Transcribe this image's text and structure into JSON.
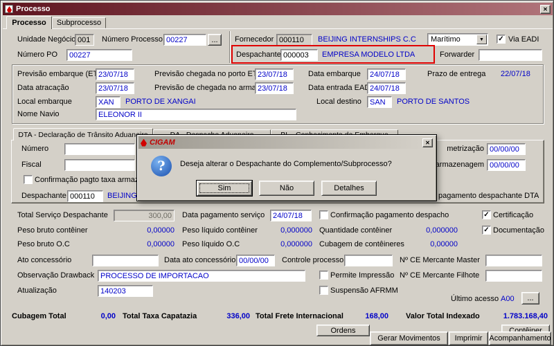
{
  "icons": {
    "close": "✕",
    "dropdown": "▼",
    "ellipsis": "...",
    "question": "?",
    "check": "✓"
  },
  "window": {
    "title": "Processo"
  },
  "main_tabs": {
    "processo": "Processo",
    "subprocesso": "Subprocesso"
  },
  "header": {
    "unidade_negocio_label": "Unidade Negócio",
    "unidade_negocio_value": "001",
    "numero_processo_label": "Número Processo",
    "numero_processo_value": "00227",
    "fornecedor_label": "Fornecedor",
    "fornecedor_code": "000110",
    "fornecedor_name": "BEIJING INTERNSHIPS C.C",
    "transporte_value": "Marítimo",
    "via_eadi_label": "Via EADI",
    "numero_po_label": "Número PO",
    "numero_po_value": "00227",
    "despachante_label": "Despachante",
    "despachante_code": "000003",
    "despachante_name": "EMPRESA MODELO LTDA",
    "forwarder_label": "Forwarder",
    "forwarder_value": ""
  },
  "dates": {
    "previsao_embarque_label": "Previsão embarque (ETD)",
    "previsao_embarque_value": "23/07/18",
    "previsao_chegada_porto_label": "Previsão chegada no porto ETA",
    "previsao_chegada_porto_value": "23/07/18",
    "data_embarque_label": "Data embarque",
    "data_embarque_value": "24/07/18",
    "prazo_entrega_label": "Prazo de entrega",
    "prazo_entrega_value": "22/07/18",
    "data_atracacao_label": "Data atracação",
    "data_atracacao_value": "23/07/18",
    "previsao_chegada_armazem_label": "Previsão de chegada no armazém",
    "previsao_chegada_armazem_value": "23/07/18",
    "data_entrada_eadi_label": "Data entrada EADI",
    "data_entrada_eadi_value": "24/07/18",
    "local_embarque_label": "Local embarque",
    "local_embarque_code": "XAN",
    "local_embarque_name": "PORTO DE XANGAI",
    "local_destino_label": "Local destino",
    "local_destino_code": "SAN",
    "local_destino_name": "PORTO DE SANTOS",
    "nome_navio_label": "Nome Navio",
    "nome_navio_value": "ELEONOR II"
  },
  "doc_tabs": {
    "dta": "DTA - Declaração de Trânsito Aduaneiro",
    "da": "DA - Despacho Aduaneiro",
    "bl": "BL - Conhecimento de Embarque"
  },
  "dta_panel": {
    "numero_label": "Número",
    "fiscal_label": "Fiscal",
    "confirmacao_pagto_label": "Confirmação pagto taxa armaze",
    "despachante_label": "Despachante",
    "despachante_code": "000110",
    "despachante_name": "BEIJING IN",
    "fragment_metrizacao": "metrização",
    "fragment_metrizacao_value": "00/00/00",
    "fragment_taxa_armazenagem": "o taxa armazenagem",
    "fragment_taxa_armazenagem_value": "00/00/00",
    "fragment_pagamento_dta": "pagamento despachante DTA"
  },
  "dialog": {
    "title": "CIGAM",
    "message": "Deseja alterar o Despachante do Complemento/Subprocesso?",
    "sim": "Sim",
    "nao": "Não",
    "detalhes": "Detalhes"
  },
  "details": {
    "total_servico_label": "Total Serviço Despachante",
    "total_servico_value": "300,00",
    "data_pagamento_label": "Data pagamento serviço",
    "data_pagamento_value": "24/07/18",
    "confirmacao_despacho_label": "Confirmação pagamento despacho",
    "certificacao_label": "Certificação",
    "peso_bruto_conteiner_label": "Peso bruto contêiner",
    "peso_bruto_conteiner_value": "0,00000",
    "peso_liquido_conteiner_label": "Peso líquido contêiner",
    "peso_liquido_conteiner_value": "0,000000",
    "quantidade_conteiner_label": "Quantidade contêiner",
    "quantidade_conteiner_value": "0,000000",
    "documentacao_label": "Documentação",
    "peso_bruto_oc_label": "Peso bruto O.C",
    "peso_bruto_oc_value": "0,00000",
    "peso_liquido_oc_label": "Peso líquido O.C",
    "peso_liquido_oc_value": "0,000000",
    "cubagem_conteineres_label": "Cubagem de contêineres",
    "cubagem_conteineres_value": "0,00000",
    "ato_concessorio_label": "Ato concessório",
    "data_ato_label": "Data ato concessório",
    "data_ato_value": "00/00/00",
    "controle_processo_label": "Controle processo",
    "ce_master_label": "Nº CE Mercante Master",
    "observacao_label": "Observação Drawback",
    "observacao_value": "PROCESSO DE IMPORTACAO",
    "permite_impressao_label": "Permite Impressão",
    "ce_filhote_label": "Nº CE Mercante Filhote",
    "atualizacao_label": "Atualização",
    "atualizacao_value": "140203",
    "suspensao_label": "Suspensão AFRMM",
    "ultimo_acesso_label": "Último acesso",
    "ultimo_acesso_value": "A00"
  },
  "totals": {
    "cubagem_label": "Cubagem Total",
    "cubagem_value": "0,00",
    "capatazia_label": "Total Taxa Capatazia",
    "capatazia_value": "336,00",
    "frete_label": "Total Frete Internacional",
    "frete_value": "168,00",
    "indexado_label": "Valor Total Indexado",
    "indexado_value": "1.783.168,40"
  },
  "footer": {
    "ordens": "Ordens",
    "gerar_movimentos": "Gerar Movimentos",
    "imprimir": "Imprimir",
    "acompanhamento": "Acompanhamento",
    "conteiner": "Contêiner"
  }
}
